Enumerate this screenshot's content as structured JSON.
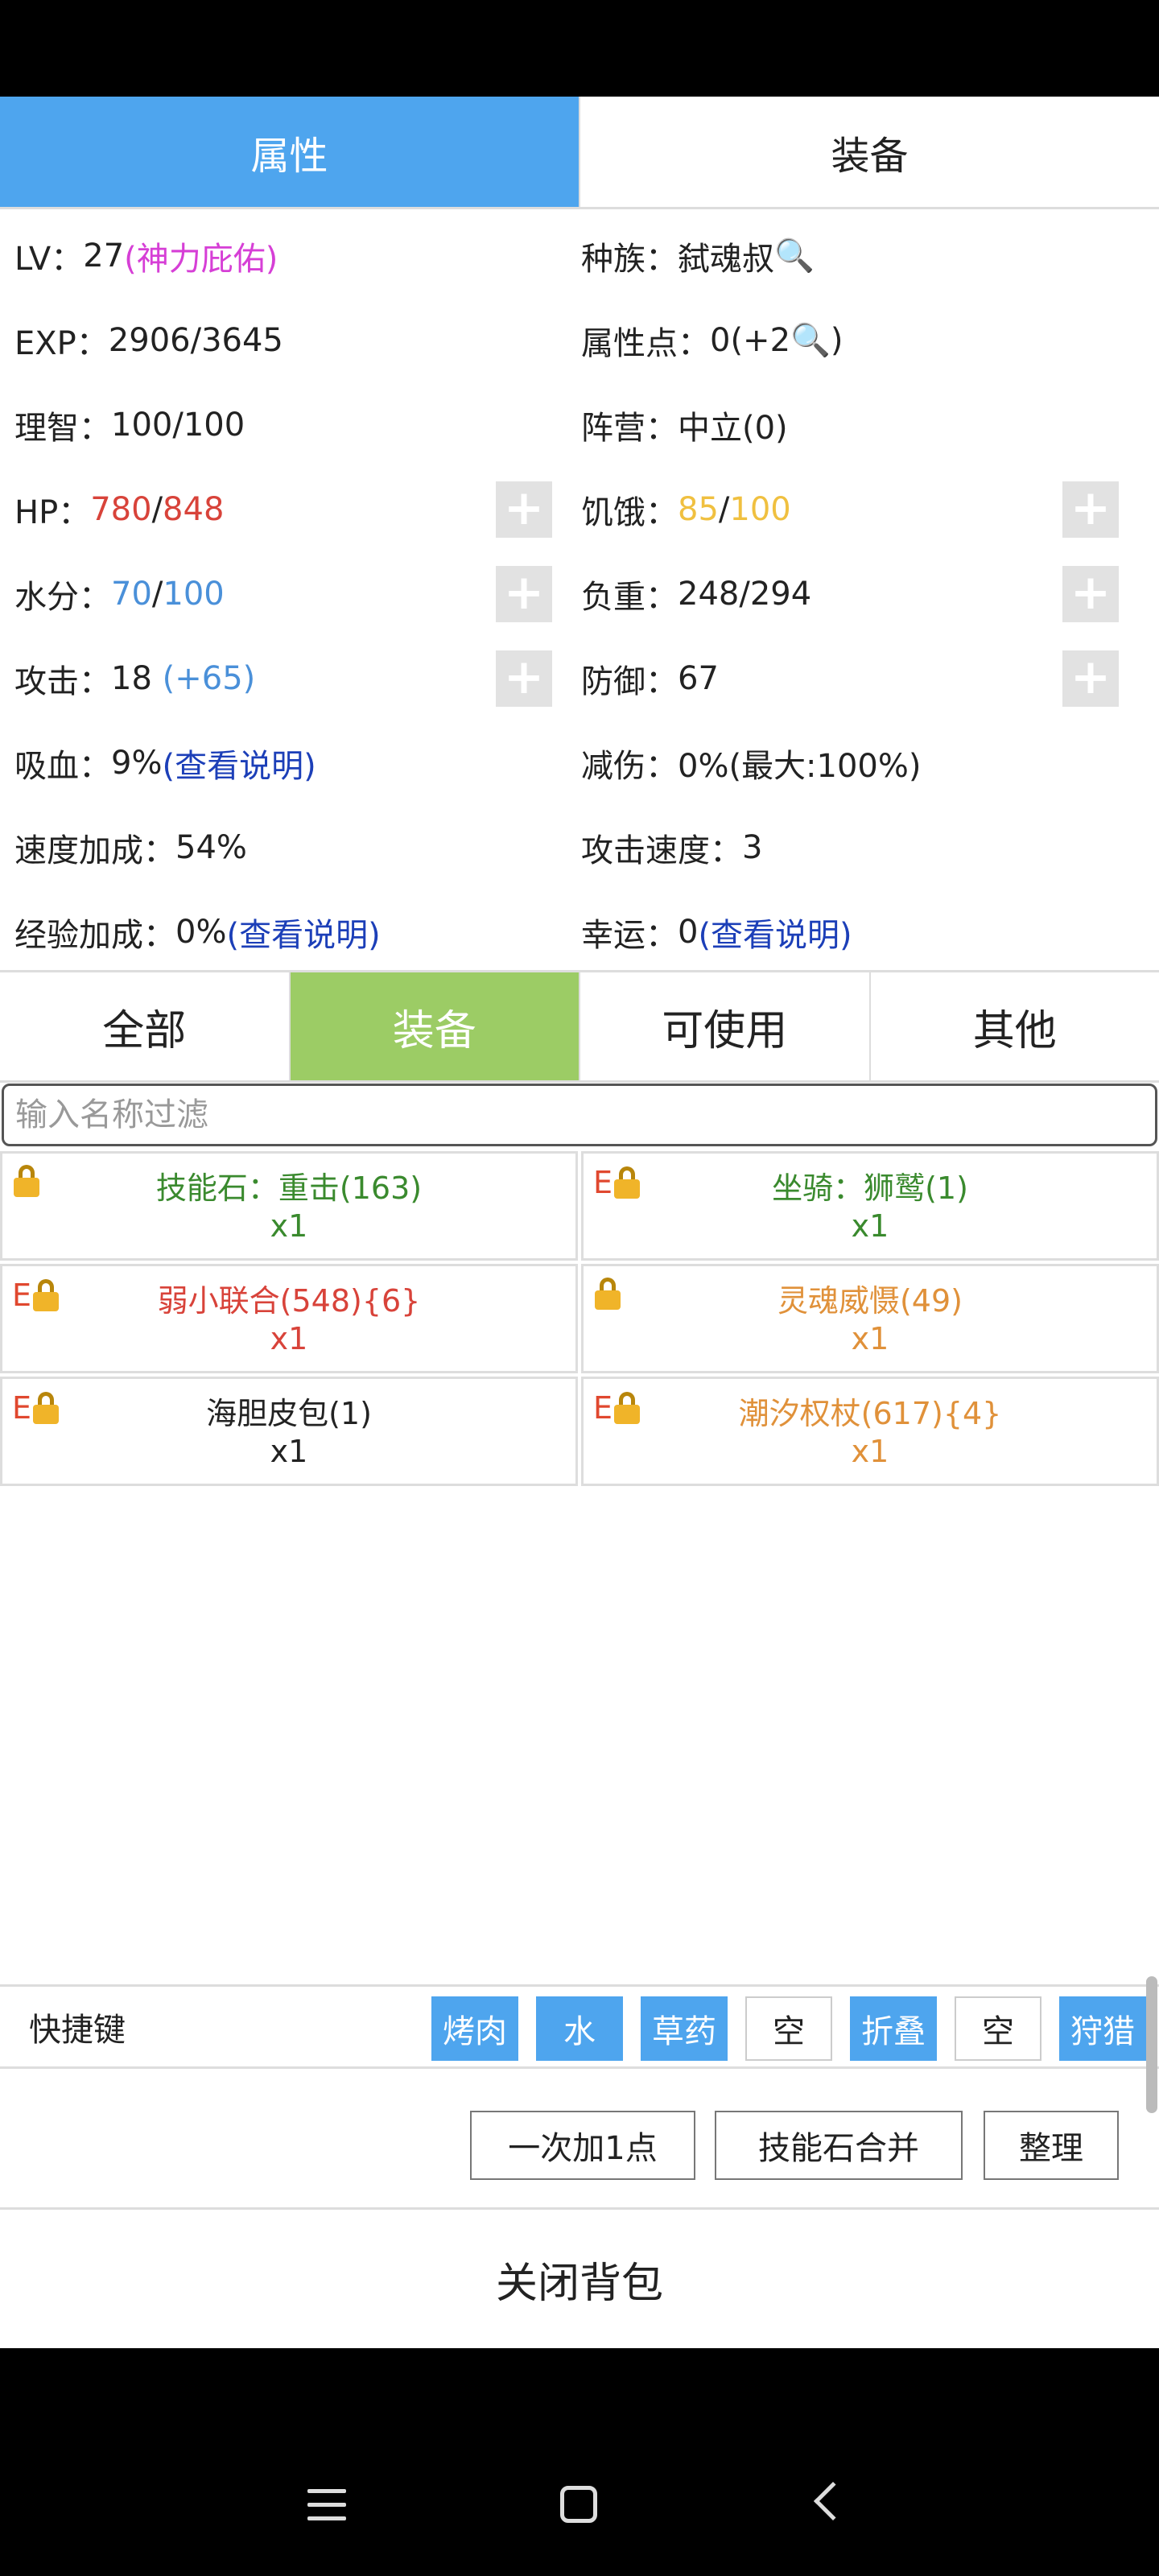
{
  "top_tabs": {
    "attributes": "属性",
    "equipment": "装备"
  },
  "stats": {
    "lv_label": "LV：",
    "lv_value": "27",
    "lv_bonus": "(神力庇佑)",
    "race_label": "种族：",
    "race_value": "弑魂叔",
    "exp_label": "EXP：",
    "exp_value": "2906/3645",
    "points_label": "属性点：",
    "points_value": "0(+2",
    "points_close": ")",
    "sanity_label": "理智：",
    "sanity_value": "100/100",
    "camp_label": "阵营：",
    "camp_value": "中立(0)",
    "hp_label": "HP：",
    "hp_cur": "780",
    "hp_sep": "/",
    "hp_max": "848",
    "hunger_label": "饥饿：",
    "hunger_cur": "85",
    "hunger_sep": "/",
    "hunger_max": "100",
    "water_label": "水分：",
    "water_cur": "70",
    "water_sep": "/",
    "water_max": "100",
    "load_label": "负重：",
    "load_value": "248/294",
    "attack_label": "攻击：",
    "attack_value": "18 ",
    "attack_bonus": "(+65)",
    "defense_label": "防御：",
    "defense_value": "67",
    "lifesteal_label": "吸血：",
    "lifesteal_value": "9%",
    "lifesteal_link": "(查看说明)",
    "reduce_label": "减伤：",
    "reduce_value": "0%(最大:100%)",
    "speed_label": "速度加成：",
    "speed_value": "54%",
    "atkspeed_label": "攻击速度：",
    "atkspeed_value": "3",
    "expbonus_label": "经验加成：",
    "expbonus_value": "0%",
    "expbonus_link": "(查看说明)",
    "luck_label": "幸运：",
    "luck_value": "0",
    "luck_link": "(查看说明)",
    "plus": "+"
  },
  "category_tabs": [
    "全部",
    "装备",
    "可使用",
    "其他"
  ],
  "filter": {
    "placeholder": "输入名称过滤"
  },
  "items": [
    {
      "equipped": "",
      "name": "技能石：重击(163)",
      "qty": "x1",
      "color": "#3a8a2e"
    },
    {
      "equipped": "E",
      "name": "坐骑：狮鹫(1)",
      "qty": "x1",
      "color": "#3a8a2e"
    },
    {
      "equipped": "E",
      "name": "弱小联合(548){6}",
      "qty": "x1",
      "color": "#d8433a"
    },
    {
      "equipped": "",
      "name": "灵魂威慑(49)",
      "qty": "x1",
      "color": "#e0913a"
    },
    {
      "equipped": "E",
      "name": "海胆皮包(1)",
      "qty": "x1",
      "color": "#222222"
    },
    {
      "equipped": "E",
      "name": "潮汐权杖(617){4}",
      "qty": "x1",
      "color": "#e0913a"
    }
  ],
  "shortcut": {
    "label": "快捷键",
    "keys": [
      "烤肉",
      "水",
      "草药",
      "空",
      "折叠",
      "空",
      "狩猎"
    ]
  },
  "actions": {
    "add_one": "一次加1点",
    "merge": "技能石合并",
    "sort": "整理"
  },
  "close": "关闭背包"
}
